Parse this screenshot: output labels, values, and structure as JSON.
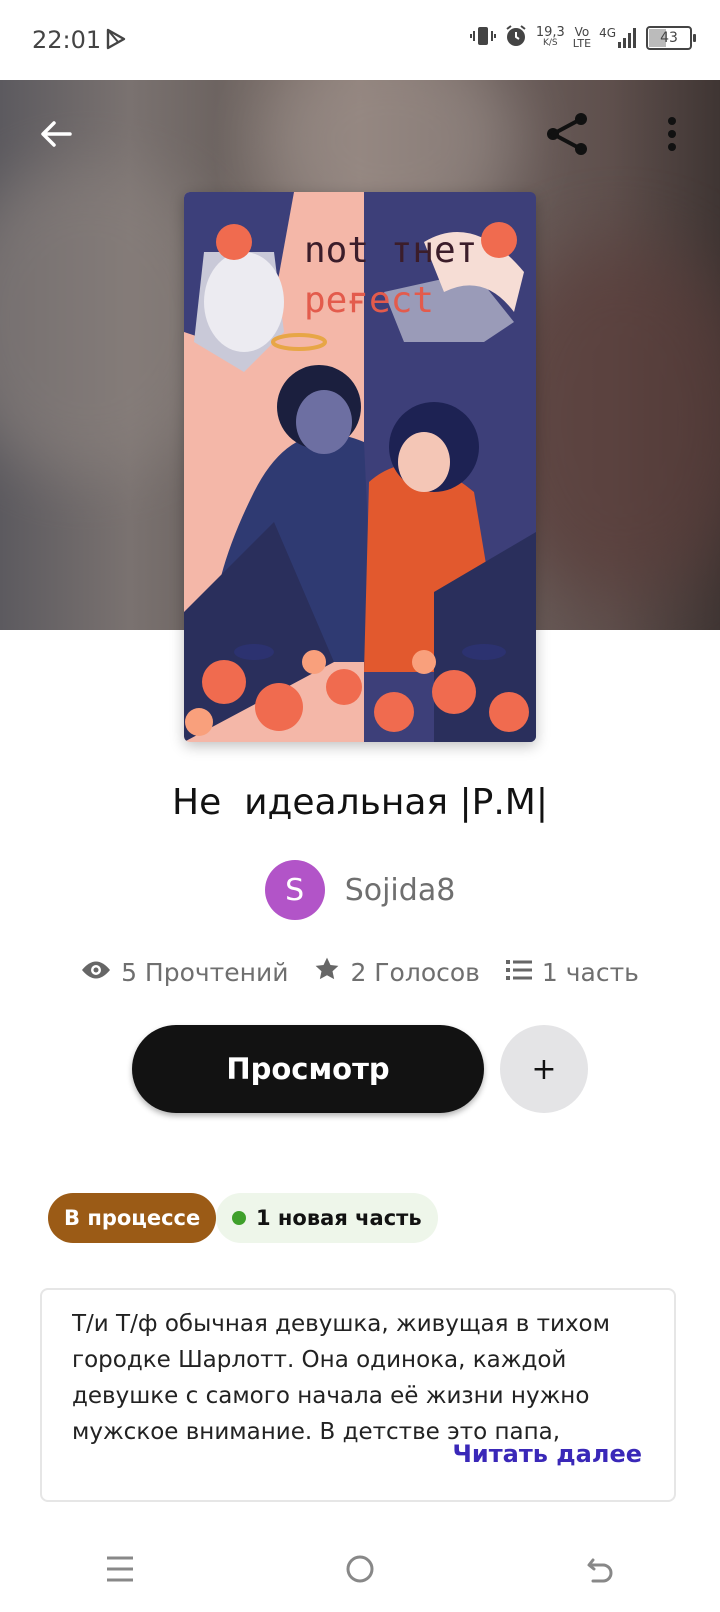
{
  "status_bar": {
    "time": "22:01",
    "speed_value": "19,3",
    "speed_unit": "K/S",
    "volte_top": "Vo",
    "volte_bottom": "LTE",
    "network": "4G",
    "battery": "43",
    "icons": [
      "play-store-icon",
      "vibrate-icon",
      "alarm-icon",
      "signal-icon",
      "battery-icon"
    ]
  },
  "toolbar": {
    "back_icon": "arrow-left-icon",
    "share_icon": "share-icon",
    "more_icon": "more-vertical-icon"
  },
  "cover": {
    "text_line1": "not тнет",
    "text_line2": "peғect"
  },
  "story": {
    "title": "Не  идеальная |Р.М|",
    "author_initial": "S",
    "author_name": "Sojida8",
    "avatar_color": "#b254c8"
  },
  "stats": {
    "reads": "5 Прочтений",
    "votes": "2 Голосов",
    "parts": "1 часть"
  },
  "actions": {
    "primary_label": "Просмотр",
    "add_label": "+"
  },
  "badges": {
    "status": "В процессе",
    "status_color": "#9b5b16",
    "new_parts": "1 новая часть"
  },
  "description": {
    "text": "Т/и Т/ф обычная девушка, живущая в тихом городке Шарлотт. Она одинока, каждой девушке с самого начала её жизни нужно мужское внимание. В детстве это папа,",
    "read_more": "Читать далее",
    "read_more_color": "#3a28b8"
  },
  "nav": {
    "icons": [
      "menu-icon",
      "home-icon",
      "back-icon"
    ]
  }
}
